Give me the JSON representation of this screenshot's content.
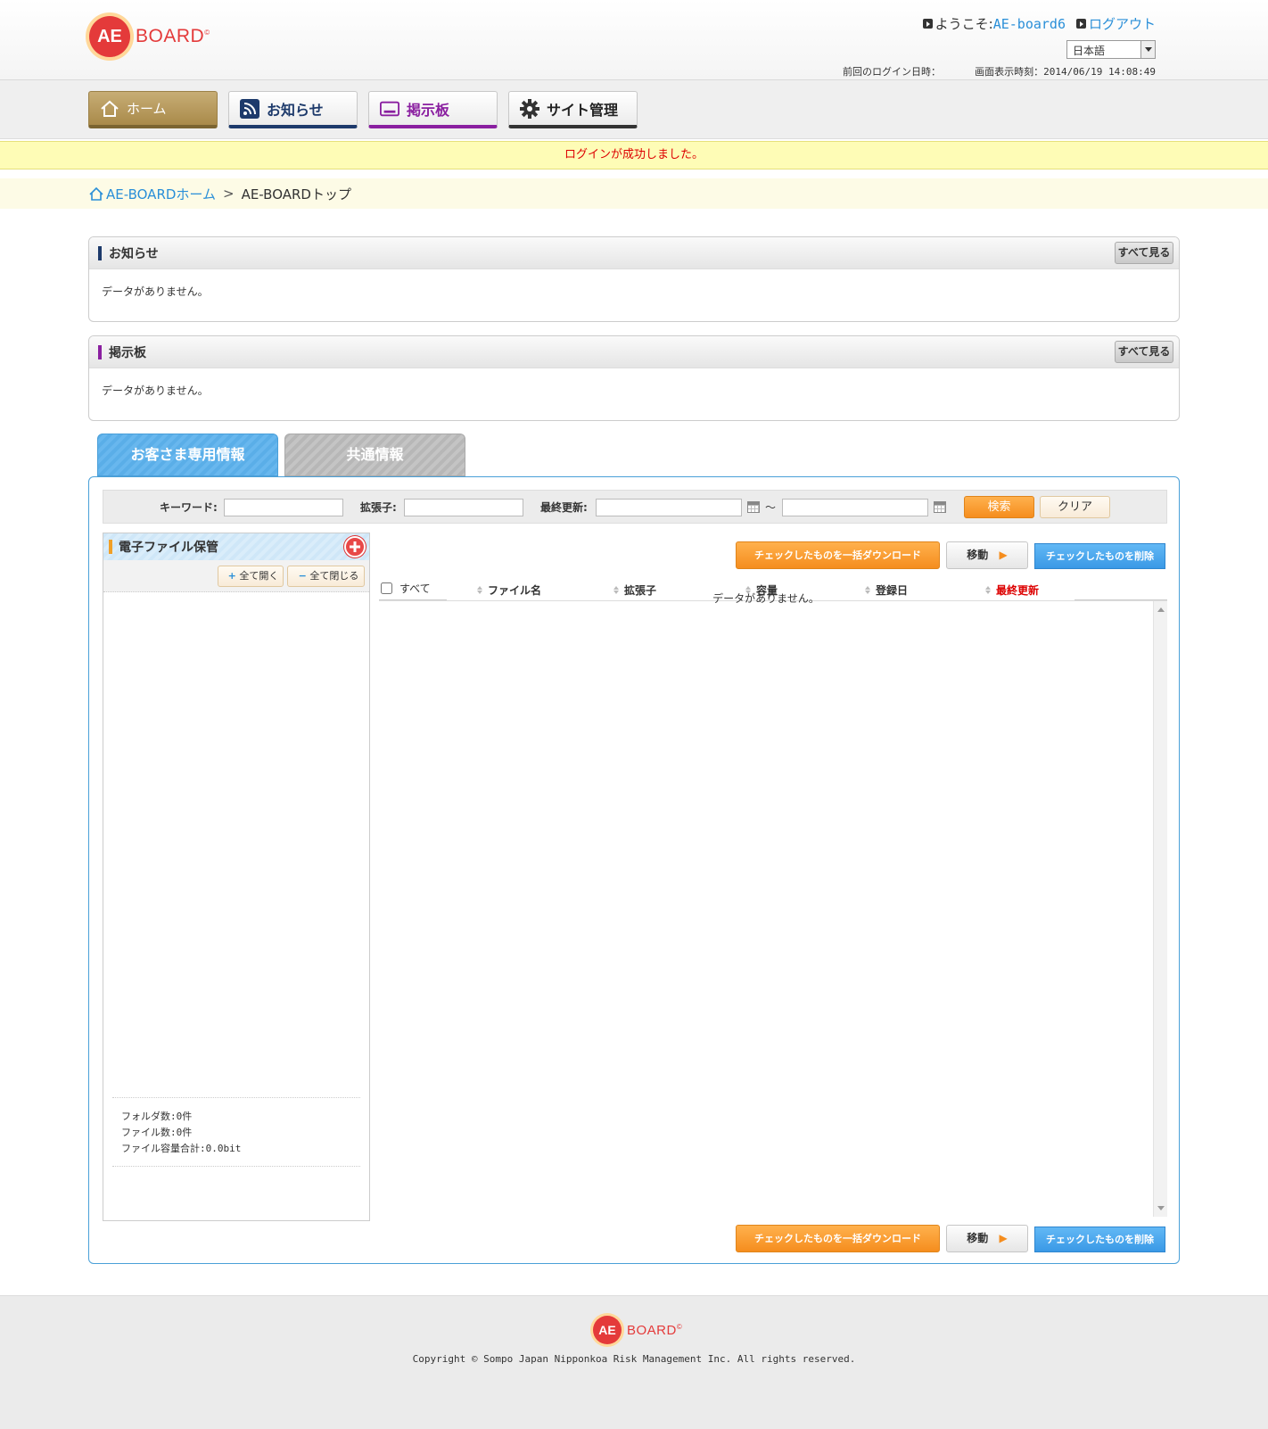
{
  "brand": {
    "logo_mark": "AE",
    "logo_text": "BOARD",
    "logo_reg": "©"
  },
  "header": {
    "welcome_prefix": "ようこそ:",
    "user_name": "AE-board6",
    "logout": "ログアウト",
    "language": "日本語",
    "last_login_label": "前回のログイン日時：",
    "display_time": "画面表示時刻：2014/06/19 14:08:49"
  },
  "nav": {
    "home": "ホーム",
    "news": "お知らせ",
    "board": "掲示板",
    "admin": "サイト管理"
  },
  "flash_message": "ログインが成功しました。",
  "breadcrumb": {
    "home": "AE-BOARDホーム",
    "current": "AE-BOARDトップ"
  },
  "panels": {
    "news": {
      "title": "お知らせ",
      "see_all": "すべて見る",
      "empty": "データがありません。"
    },
    "board": {
      "title": "掲示板",
      "see_all": "すべて見る",
      "empty": "データがありません。"
    }
  },
  "tabs": {
    "customer": "お客さま専用情報",
    "common": "共通情報"
  },
  "search": {
    "keyword_label": "キーワード:",
    "keyword_value": "",
    "ext_label": "拡張子:",
    "ext_value": "",
    "updated_label": "最終更新:",
    "date_from": "",
    "date_to": "",
    "range_sep": "～",
    "search_btn": "検索",
    "clear_btn": "クリア"
  },
  "folder": {
    "title": "電子ファイル保管",
    "expand_all": "全て開く",
    "collapse_all": "全て閉じる",
    "folder_count": "フォルダ数:0件",
    "file_count": "ファイル数:0件",
    "total_size": "ファイル容量合計:0.0bit"
  },
  "file_actions": {
    "download": "チェックしたものを一括ダウンロード",
    "move": "移動",
    "delete": "チェックしたものを削除"
  },
  "file_table": {
    "select_all": "すべて",
    "columns": [
      "ファイル名",
      "拡張子",
      "容量",
      "登録日",
      "最終更新"
    ],
    "empty": "データがありません。"
  },
  "footer": {
    "copyright": "Copyright © Sompo Japan Nipponkoa Risk Management Inc. All rights reserved."
  },
  "colors": {
    "accent_red": "#e43a3a",
    "sort_active": "#dd0000",
    "link": "#2a8fd8"
  }
}
